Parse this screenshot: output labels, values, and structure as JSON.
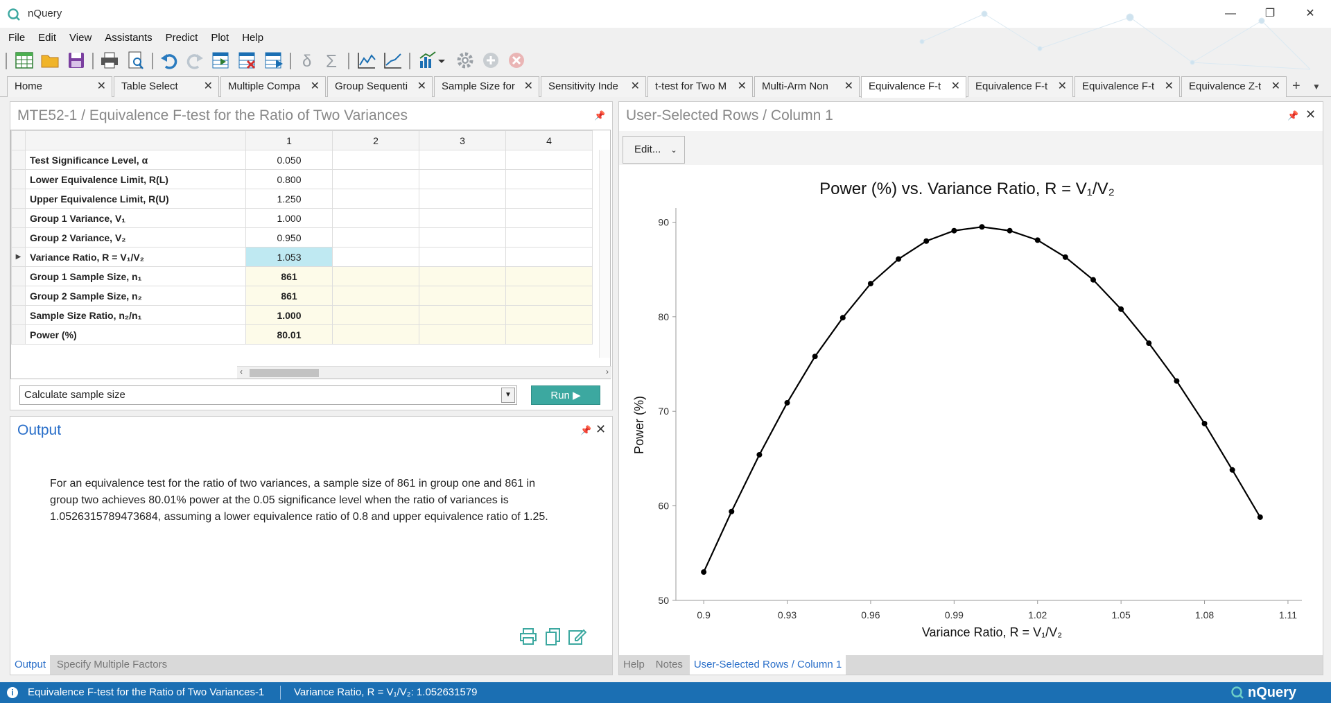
{
  "window": {
    "title": "nQuery"
  },
  "menu": {
    "items": [
      "File",
      "Edit",
      "View",
      "Assistants",
      "Predict",
      "Plot",
      "Help"
    ]
  },
  "toolbar": {
    "icons": [
      "new-table-icon",
      "open-folder-icon",
      "save-icon",
      "print-icon",
      "print-preview-icon",
      "undo-icon",
      "redo-icon",
      "insert-rows-icon",
      "delete-rows-icon",
      "append-rows-icon",
      "delta-icon",
      "sigma-icon",
      "line-plot-icon",
      "line-plot-2-icon",
      "bar-chart-icon",
      "settings-icon",
      "add-icon",
      "cancel-icon"
    ]
  },
  "tabs": [
    {
      "label": "Home",
      "active": false
    },
    {
      "label": "Table Select",
      "active": false
    },
    {
      "label": "Multiple Compa",
      "active": false
    },
    {
      "label": "Group Sequenti",
      "active": false
    },
    {
      "label": "Sample Size for",
      "active": false
    },
    {
      "label": "Sensitivity Inde",
      "active": false
    },
    {
      "label": "t-test for Two M",
      "active": false
    },
    {
      "label": "Multi-Arm Non",
      "active": false
    },
    {
      "label": "Equivalence F-t",
      "active": true
    },
    {
      "label": "Equivalence F-t",
      "active": false
    },
    {
      "label": "Equivalence F-t",
      "active": false
    },
    {
      "label": "Equivalence Z-t",
      "active": false
    }
  ],
  "table_panel": {
    "title": "MTE52-1 / Equivalence F-test for the Ratio of Two Variances",
    "columns": [
      "1",
      "2",
      "3",
      "4"
    ],
    "rows": [
      {
        "label": "Test Significance Level, α",
        "value": "0.050",
        "type": "input"
      },
      {
        "label": "Lower Equivalence Limit, R(L)",
        "value": "0.800",
        "type": "input"
      },
      {
        "label": "Upper Equivalence Limit, R(U)",
        "value": "1.250",
        "type": "input"
      },
      {
        "label": "Group 1 Variance, V₁",
        "value": "1.000",
        "type": "input"
      },
      {
        "label": "Group 2 Variance, V₂",
        "value": "0.950",
        "type": "input"
      },
      {
        "label": "Variance Ratio, R = V₁/V₂",
        "value": "1.053",
        "type": "selected"
      },
      {
        "label": "Group 1 Sample Size, n₁",
        "value": "861",
        "type": "output"
      },
      {
        "label": "Group 2 Sample Size, n₂",
        "value": "861",
        "type": "output"
      },
      {
        "label": "Sample Size Ratio, n₂/n₁",
        "value": "1.000",
        "type": "output"
      },
      {
        "label": "Power (%)",
        "value": "80.01",
        "type": "output"
      }
    ],
    "calc_option": "Calculate sample size",
    "run_label": "Run"
  },
  "output_panel": {
    "title": "Output",
    "text": "For an equivalence test for the ratio of two variances, a sample size of 861 in group one and 861 in group two achieves 80.01% power at the 0.05 significance level when the ratio of variances is 1.0526315789473684, assuming a lower equivalence ratio of 0.8 and upper equivalence ratio of 1.25.",
    "tabs": [
      "Output",
      "Specify Multiple Factors"
    ]
  },
  "plot_panel": {
    "title": "User-Selected Rows / Column 1",
    "edit_label": "Edit...",
    "tabs": [
      "Help",
      "Notes",
      "User-Selected Rows / Column 1"
    ]
  },
  "chart_data": {
    "type": "line",
    "title": "Power (%) vs. Variance Ratio, R = V₁/V₂",
    "xlabel": "Variance Ratio, R = V₁/V₂",
    "ylabel": "Power (%)",
    "xlim": [
      0.89,
      1.115
    ],
    "ylim": [
      50,
      91.5
    ],
    "xticks": [
      0.9,
      0.93,
      0.96,
      0.99,
      1.02,
      1.05,
      1.08,
      1.11
    ],
    "xtick_labels": [
      "0.9",
      "0.93",
      "0.96",
      "0.99",
      "1.02",
      "1.05",
      "1.08",
      "1.11"
    ],
    "yticks": [
      50,
      60,
      70,
      80,
      90
    ],
    "ytick_labels": [
      "50",
      "60",
      "70",
      "80",
      "90"
    ],
    "x": [
      0.9,
      0.91,
      0.92,
      0.93,
      0.94,
      0.95,
      0.96,
      0.97,
      0.98,
      0.99,
      1.0,
      1.01,
      1.02,
      1.03,
      1.04,
      1.05,
      1.06,
      1.07,
      1.08,
      1.09,
      1.1
    ],
    "y": [
      53.0,
      59.4,
      65.4,
      70.9,
      75.8,
      79.9,
      83.5,
      86.1,
      88.0,
      89.1,
      89.5,
      89.1,
      88.1,
      86.3,
      83.9,
      80.8,
      77.2,
      73.2,
      68.7,
      63.8,
      58.8
    ],
    "grid": false,
    "color": "#000000"
  },
  "status": {
    "left": "Equivalence F-test for the Ratio of Two Variances-1",
    "right": "Variance Ratio, R = V₁/V₂: 1.052631579",
    "brand": "nQuery"
  }
}
